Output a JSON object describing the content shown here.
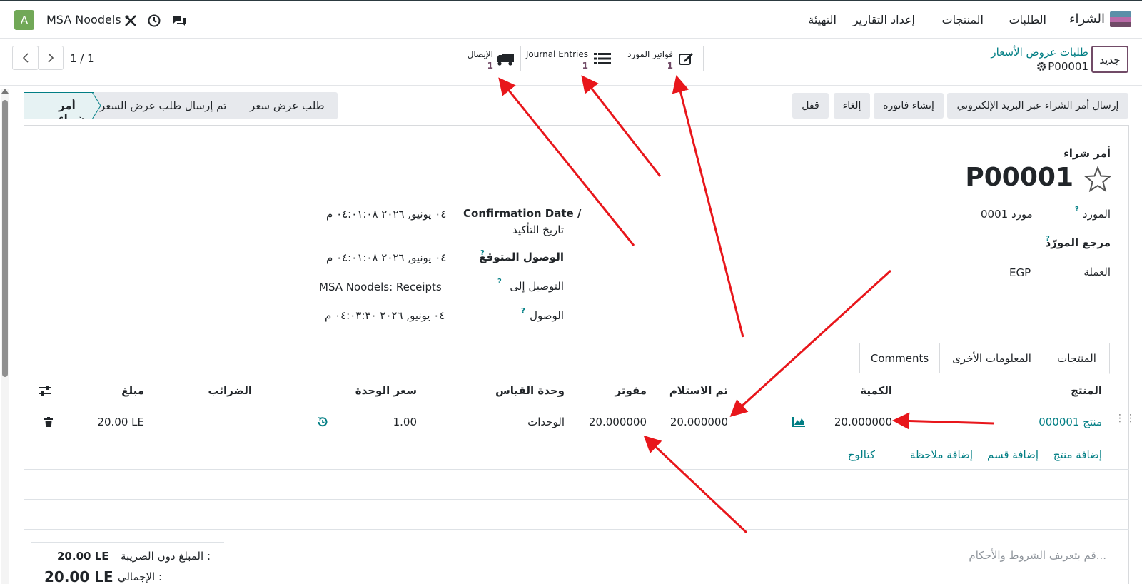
{
  "navbar": {
    "app": "الشراء",
    "menu": [
      "الطلبات",
      "المنتجات",
      "إعداد التقارير",
      "التهيئة"
    ],
    "company": "MSA Noodels",
    "avatar": "A"
  },
  "control": {
    "new_btn": "جديد",
    "breadcrumb_parent": "طلبات عروض الأسعار",
    "record": "P00001",
    "pager": "1 / 1"
  },
  "smart_buttons": [
    {
      "label": "فواتير المورد",
      "count": "1",
      "icon": "pencil-square-icon"
    },
    {
      "label": "Journal Entries",
      "count": "1",
      "icon": "list-icon"
    },
    {
      "label": "الإيصال",
      "count": "1",
      "icon": "truck-icon"
    }
  ],
  "actions": {
    "send_email": "إرسال أمر الشراء عبر البريد الإلكتروني",
    "create_bill": "إنشاء فاتورة",
    "cancel": "إلغاء",
    "lock": "قفل"
  },
  "statusbar": {
    "stages": [
      "أمر شراء",
      "تم إرسال طلب عرض السعر",
      "طلب عرض سعر"
    ],
    "active": "أمر شراء"
  },
  "form": {
    "title_label": "أمر شراء",
    "name": "P00001",
    "vendor_label": "المورد",
    "vendor": "مورد 0001",
    "vendor_ref_label": "مرجع المورّد",
    "currency_label": "العملة",
    "currency": "EGP",
    "confirmation_date_label_en": "Confirmation Date /",
    "confirmation_date_label_ar": "تاريخ التأكيد",
    "confirmation_date": "٠٤ يونيو, ٢٠٢٦ ٠٤:٠١:٠٨ م",
    "expected_arrival_label": "الوصول المتوقع",
    "expected_arrival": "٠٤ يونيو, ٢٠٢٦ ٠٤:٠١:٠٨ م",
    "deliver_to_label": "التوصيل إلى",
    "deliver_to": "MSA Noodels: Receipts",
    "arrival_label": "الوصول",
    "arrival": "٠٤ يونيو, ٢٠٢٦ ٠٤:٠٣:٣٠ م"
  },
  "tabs": [
    "المنتجات",
    "المعلومات الأخرى",
    "Comments"
  ],
  "table": {
    "headers": {
      "product": "المنتج",
      "quantity": "الكمية",
      "received": "تم الاستلام",
      "billed": "مفوتر",
      "uom": "وحدة القياس",
      "unit_price": "سعر الوحدة",
      "taxes": "الضرائب",
      "amount": "مبلغ"
    },
    "rows": [
      {
        "product": "منتج 000001",
        "quantity": "20.000000",
        "received": "20.000000",
        "billed": "20.000000",
        "uom": "الوحدات",
        "unit_price": "1.00",
        "taxes": "",
        "amount": "20.00 LE"
      }
    ],
    "add_links": {
      "add_product": "إضافة منتج",
      "add_section": "إضافة قسم",
      "add_note": "إضافة ملاحظة",
      "catalog": "كتالوج"
    }
  },
  "totals": {
    "untaxed_label": "المبلغ دون الضريبة :",
    "untaxed": "20.00 LE",
    "total_label": "الإجمالي :",
    "total": "20.00 LE"
  },
  "terms_placeholder": "قم بتعريف الشروط والأحكام...",
  "colors": {
    "primary": "#714b67",
    "link": "#017e84",
    "annotation": "#e8161b"
  }
}
